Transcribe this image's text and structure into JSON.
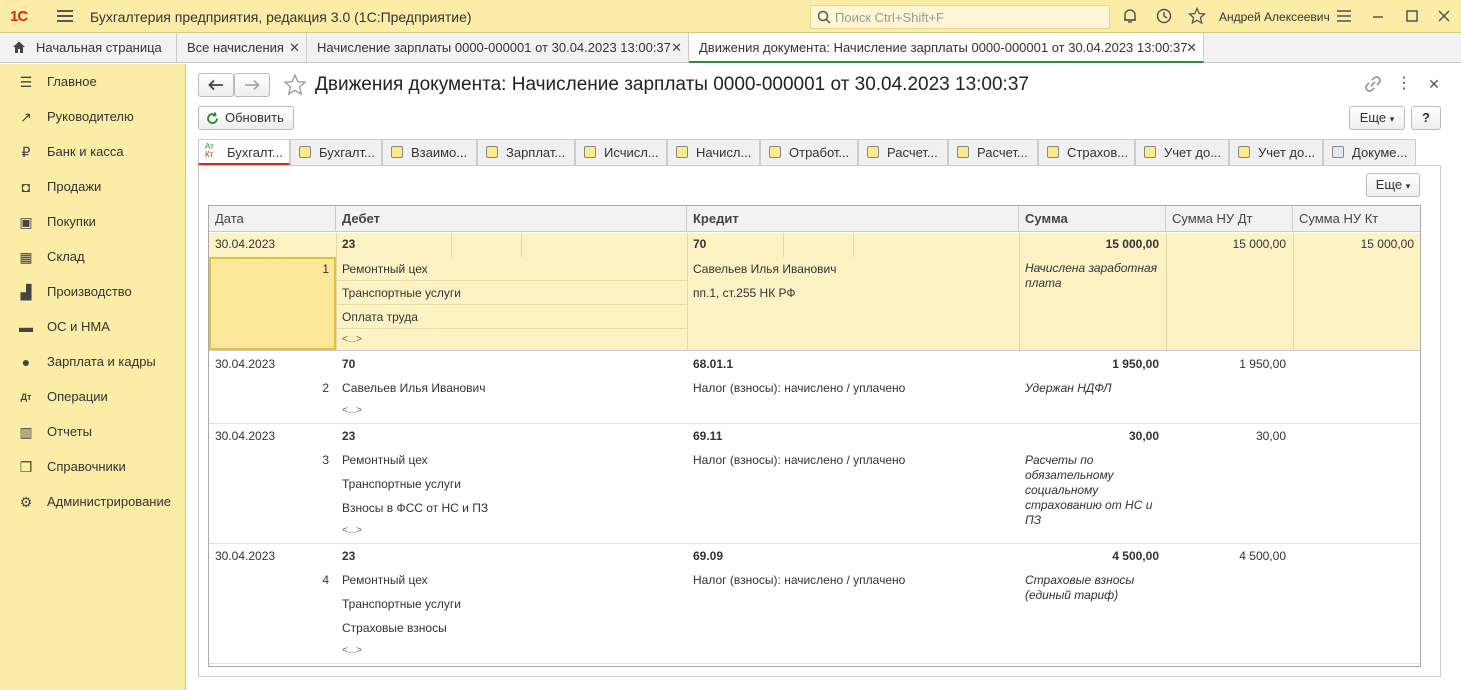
{
  "app": {
    "logo": "1С",
    "title": "Бухгалтерия предприятия, редакция 3.0  (1С:Предприятие)",
    "search_placeholder": "Поиск Ctrl+Shift+F",
    "user": "Андрей Алексеевич"
  },
  "open_tabs": [
    {
      "label": "Начальная страница"
    },
    {
      "label": "Все начисления"
    },
    {
      "label": "Начисление зарплаты 0000-000001 от 30.04.2023 13:00:37"
    },
    {
      "label": "Движения документа: Начисление зарплаты 0000-000001 от 30.04.2023 13:00:37"
    }
  ],
  "sidebar": {
    "items": [
      {
        "label": "Главное",
        "icon": "menu-icon"
      },
      {
        "label": "Руководителю",
        "icon": "trend-icon"
      },
      {
        "label": "Банк и касса",
        "icon": "ruble-icon"
      },
      {
        "label": "Продажи",
        "icon": "bag-icon"
      },
      {
        "label": "Покупки",
        "icon": "cart-icon"
      },
      {
        "label": "Склад",
        "icon": "warehouse-icon"
      },
      {
        "label": "Производство",
        "icon": "factory-icon"
      },
      {
        "label": "ОС и НМА",
        "icon": "truck-icon"
      },
      {
        "label": "Зарплата и кадры",
        "icon": "person-icon"
      },
      {
        "label": "Операции",
        "icon": "dtkt-icon"
      },
      {
        "label": "Отчеты",
        "icon": "chart-icon"
      },
      {
        "label": "Справочники",
        "icon": "book-icon"
      },
      {
        "label": "Администрирование",
        "icon": "gear-icon"
      }
    ]
  },
  "form": {
    "title": "Движения документа: Начисление зарплаты 0000-000001 от 30.04.2023 13:00:37",
    "refresh_label": "Обновить",
    "more_label": "Еще",
    "help_label": "?",
    "grid_more_label": "Еще"
  },
  "subtabs": [
    {
      "label": "Бухгалт..."
    },
    {
      "label": "Бухгалт..."
    },
    {
      "label": "Взаимо..."
    },
    {
      "label": "Зарплат..."
    },
    {
      "label": "Исчисл..."
    },
    {
      "label": "Начисл..."
    },
    {
      "label": "Отработ..."
    },
    {
      "label": "Расчет..."
    },
    {
      "label": "Расчет..."
    },
    {
      "label": "Страхов..."
    },
    {
      "label": "Учет до..."
    },
    {
      "label": "Учет до..."
    },
    {
      "label": "Докуме..."
    }
  ],
  "grid": {
    "columns": [
      "Дата",
      "Дебет",
      "Кредит",
      "Сумма",
      "Сумма НУ Дт",
      "Сумма НУ Кт"
    ],
    "more_marker": "<...>",
    "rows": [
      {
        "date": "30.04.2023",
        "num": "1",
        "debit": "23",
        "debit_sub": [
          "Ремонтный цех",
          "Транспортные услуги",
          "Оплата труда"
        ],
        "credit": "70",
        "credit_sub": [
          "Савельев Илья Иванович",
          "пп.1, ст.255 НК РФ"
        ],
        "sum": "15 000,00",
        "content": "Начислена заработная плата",
        "nu_dt": "15 000,00",
        "nu_kt": "15 000,00"
      },
      {
        "date": "30.04.2023",
        "num": "2",
        "debit": "70",
        "debit_sub": [
          "Савельев Илья Иванович"
        ],
        "credit": "68.01.1",
        "credit_sub": [
          "Налог (взносы): начислено / уплачено"
        ],
        "sum": "1 950,00",
        "content": "Удержан НДФЛ",
        "nu_dt": "1 950,00",
        "nu_kt": ""
      },
      {
        "date": "30.04.2023",
        "num": "3",
        "debit": "23",
        "debit_sub": [
          "Ремонтный цех",
          "Транспортные услуги",
          "Взносы в ФСС от НС и ПЗ"
        ],
        "credit": "69.11",
        "credit_sub": [
          "Налог (взносы): начислено / уплачено"
        ],
        "sum": "30,00",
        "content": "Расчеты по обязательному социальному страхованию от НС и ПЗ",
        "nu_dt": "30,00",
        "nu_kt": ""
      },
      {
        "date": "30.04.2023",
        "num": "4",
        "debit": "23",
        "debit_sub": [
          "Ремонтный цех",
          "Транспортные услуги",
          "Страховые взносы"
        ],
        "credit": "69.09",
        "credit_sub": [
          "Налог (взносы): начислено / уплачено"
        ],
        "sum": "4 500,00",
        "content": "Страховые взносы (единый тариф)",
        "nu_dt": "4 500,00",
        "nu_kt": ""
      }
    ]
  },
  "colors": {
    "accent": "#2d8a3e",
    "brand": "#d52b1e",
    "panel": "#fbeca6",
    "selected_row": "#fdf2c4"
  }
}
